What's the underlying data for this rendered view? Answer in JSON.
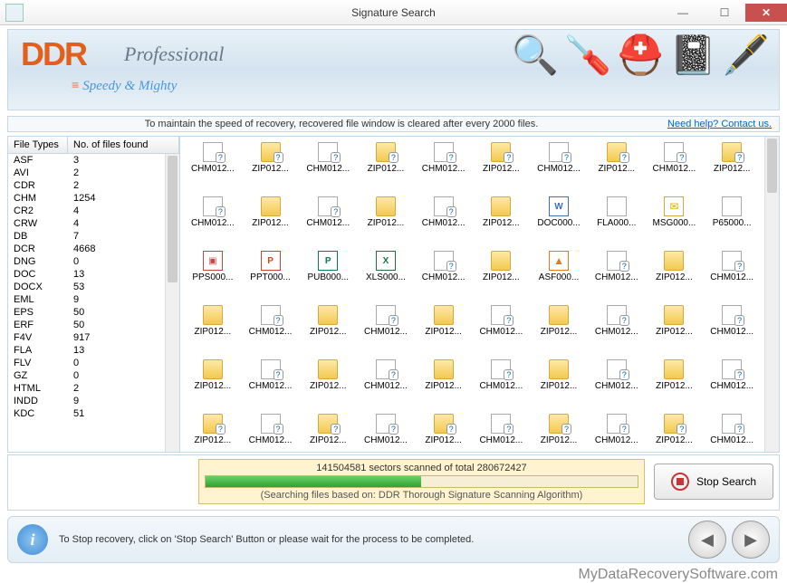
{
  "window": {
    "title": "Signature Search"
  },
  "banner": {
    "brand": "DDR",
    "suite": "Professional",
    "tagline": "Speedy & Mighty"
  },
  "infostrip": {
    "msg": "To maintain the speed of recovery, recovered file window is cleared after every 2000 files.",
    "help": "Need help? Contact us."
  },
  "ft_table": {
    "col1": "File Types",
    "col2": "No. of files found",
    "rows": [
      {
        "t": "ASF",
        "n": "3"
      },
      {
        "t": "AVI",
        "n": "2"
      },
      {
        "t": "CDR",
        "n": "2"
      },
      {
        "t": "CHM",
        "n": "1254"
      },
      {
        "t": "CR2",
        "n": "4"
      },
      {
        "t": "CRW",
        "n": "4"
      },
      {
        "t": "DB",
        "n": "7"
      },
      {
        "t": "DCR",
        "n": "4668"
      },
      {
        "t": "DNG",
        "n": "0"
      },
      {
        "t": "DOC",
        "n": "13"
      },
      {
        "t": "DOCX",
        "n": "53"
      },
      {
        "t": "EML",
        "n": "9"
      },
      {
        "t": "EPS",
        "n": "50"
      },
      {
        "t": "ERF",
        "n": "50"
      },
      {
        "t": "F4V",
        "n": "917"
      },
      {
        "t": "FLA",
        "n": "13"
      },
      {
        "t": "FLV",
        "n": "0"
      },
      {
        "t": "GZ",
        "n": "0"
      },
      {
        "t": "HTML",
        "n": "2"
      },
      {
        "t": "INDD",
        "n": "9"
      },
      {
        "t": "KDC",
        "n": "51"
      }
    ]
  },
  "files": [
    {
      "l": "CHM012...",
      "i": "pageq"
    },
    {
      "l": "ZIP012...",
      "i": "folderq"
    },
    {
      "l": "CHM012...",
      "i": "pageq"
    },
    {
      "l": "ZIP012...",
      "i": "folderq"
    },
    {
      "l": "CHM012...",
      "i": "pageq"
    },
    {
      "l": "ZIP012...",
      "i": "folderq"
    },
    {
      "l": "CHM012...",
      "i": "pageq"
    },
    {
      "l": "ZIP012...",
      "i": "folderq"
    },
    {
      "l": "CHM012...",
      "i": "pageq"
    },
    {
      "l": "ZIP012...",
      "i": "folderq"
    },
    {
      "l": "CHM012...",
      "i": "pageq"
    },
    {
      "l": "ZIP012...",
      "i": "folder"
    },
    {
      "l": "CHM012...",
      "i": "pageq"
    },
    {
      "l": "ZIP012...",
      "i": "folder"
    },
    {
      "l": "CHM012...",
      "i": "pageq"
    },
    {
      "l": "ZIP012...",
      "i": "folder"
    },
    {
      "l": "DOC000...",
      "i": "doc"
    },
    {
      "l": "FLA000...",
      "i": "page"
    },
    {
      "l": "MSG000...",
      "i": "msg"
    },
    {
      "l": "P65000...",
      "i": "page"
    },
    {
      "l": "PPS000...",
      "i": "pps"
    },
    {
      "l": "PPT000...",
      "i": "ppt"
    },
    {
      "l": "PUB000...",
      "i": "pub"
    },
    {
      "l": "XLS000...",
      "i": "xls"
    },
    {
      "l": "CHM012...",
      "i": "pageq"
    },
    {
      "l": "ZIP012...",
      "i": "folder"
    },
    {
      "l": "ASF000...",
      "i": "asf"
    },
    {
      "l": "CHM012...",
      "i": "pageq"
    },
    {
      "l": "ZIP012...",
      "i": "folder"
    },
    {
      "l": "CHM012...",
      "i": "pageq"
    },
    {
      "l": "ZIP012...",
      "i": "folder"
    },
    {
      "l": "CHM012...",
      "i": "pageq"
    },
    {
      "l": "ZIP012...",
      "i": "folder"
    },
    {
      "l": "CHM012...",
      "i": "pageq"
    },
    {
      "l": "ZIP012...",
      "i": "folder"
    },
    {
      "l": "CHM012...",
      "i": "pageq"
    },
    {
      "l": "ZIP012...",
      "i": "folder"
    },
    {
      "l": "CHM012...",
      "i": "pageq"
    },
    {
      "l": "ZIP012...",
      "i": "folder"
    },
    {
      "l": "CHM012...",
      "i": "pageq"
    },
    {
      "l": "ZIP012...",
      "i": "folder"
    },
    {
      "l": "CHM012...",
      "i": "pageq"
    },
    {
      "l": "ZIP012...",
      "i": "folder"
    },
    {
      "l": "CHM012...",
      "i": "pageq"
    },
    {
      "l": "ZIP012...",
      "i": "folder"
    },
    {
      "l": "CHM012...",
      "i": "pageq"
    },
    {
      "l": "ZIP012...",
      "i": "folder"
    },
    {
      "l": "CHM012...",
      "i": "pageq"
    },
    {
      "l": "ZIP012...",
      "i": "folder"
    },
    {
      "l": "CHM012...",
      "i": "pageq"
    },
    {
      "l": "ZIP012...",
      "i": "folderq"
    },
    {
      "l": "CHM012...",
      "i": "pageq"
    },
    {
      "l": "ZIP012...",
      "i": "folderq"
    },
    {
      "l": "CHM012...",
      "i": "pageq"
    },
    {
      "l": "ZIP012...",
      "i": "folderq"
    },
    {
      "l": "CHM012...",
      "i": "pageq"
    },
    {
      "l": "ZIP012...",
      "i": "folderq"
    },
    {
      "l": "CHM012...",
      "i": "pageq"
    },
    {
      "l": "ZIP012...",
      "i": "folderq"
    },
    {
      "l": "CHM012...",
      "i": "pageq"
    }
  ],
  "progress": {
    "label": "141504581 sectors scanned of total 280672427",
    "percent": 50,
    "note": "(Searching files based on:  DDR Thorough Signature Scanning Algorithm)",
    "stop": "Stop Search"
  },
  "footer": {
    "msg": "To Stop recovery, click on 'Stop Search' Button or please wait for the process to be completed."
  },
  "watermark": "MyDataRecoverySoftware.com"
}
